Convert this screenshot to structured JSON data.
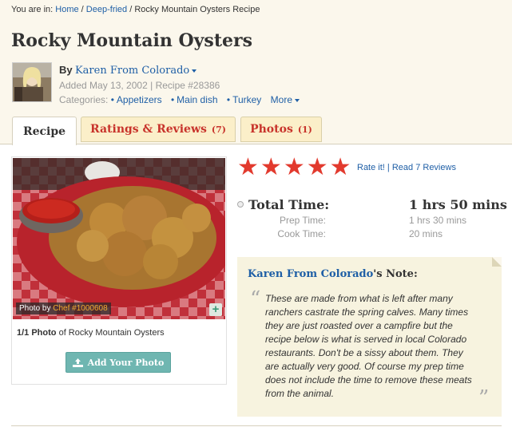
{
  "breadcrumb": {
    "prefix": "You are in:",
    "home": "Home",
    "sep1": "/",
    "category": "Deep-fried",
    "sep2": "/",
    "current": "Rocky Mountain Oysters Recipe"
  },
  "recipe": {
    "title": "Rocky Mountain Oysters",
    "by_label": "By",
    "author": "Karen From Colorado",
    "added": "Added May 13, 2002",
    "divider": "|",
    "recipe_number": "Recipe #28386",
    "categories_label": "Categories:",
    "categories": [
      "Appetizers",
      "Main dish",
      "Turkey"
    ],
    "more_label": "More"
  },
  "tabs": [
    {
      "label": "Recipe",
      "count": ""
    },
    {
      "label": "Ratings & Reviews",
      "count": "(7)"
    },
    {
      "label": "Photos",
      "count": "(1)"
    }
  ],
  "photo": {
    "credit_prefix": "Photo by",
    "credit_user": "Chef #1000608",
    "plus_label": "+",
    "caption_bold": "1/1 Photo",
    "caption_rest": "of Rocky Mountain Oysters",
    "add_button": "Add Your Photo"
  },
  "rating": {
    "stars": 5,
    "rate_it": "Rate it!",
    "divider": "|",
    "read_reviews": "Read 7 Reviews"
  },
  "time": {
    "total_label": "Total Time:",
    "total_value": "1 hrs 50 mins",
    "prep_label": "Prep Time:",
    "prep_value": "1 hrs 30 mins",
    "cook_label": "Cook Time:",
    "cook_value": "20 mins"
  },
  "note": {
    "author": "Karen From Colorado",
    "suffix": "'s Note:",
    "open_quote": "“",
    "close_quote": "”",
    "text": "These are made from what is left after many ranchers castrate the spring calves. Many times they are just roasted over a campfire but the recipe below is what is served in local Colorado restaurants. Don't be a sissy about them. They are actually very good. Of course my prep time does not include the time to remove these meats from the animal."
  },
  "colors": {
    "accent_red": "#e23a2e",
    "link_blue": "#1f5fa6",
    "button_teal": "#6fb6b1",
    "page_bg": "#fbf7ec"
  }
}
